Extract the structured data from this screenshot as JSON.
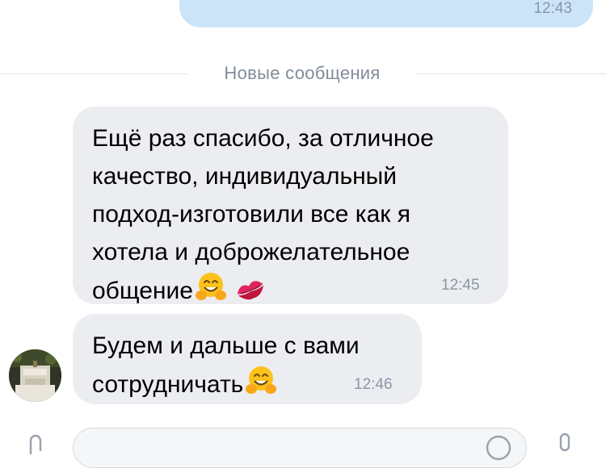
{
  "outgoing_message": {
    "time": "12:43"
  },
  "divider": {
    "label": "Новые сообщения"
  },
  "messages": [
    {
      "text": "Ещё раз спасибо, за отличное\nкачество, индивидуальный\nподход-изготовили все как я\nхотела и доброжелательное\nобщение",
      "emojis": [
        "hugging-face",
        "kiss-mark"
      ],
      "time": "12:45"
    },
    {
      "text": "Будем и дальше с вами\nсотрудничать",
      "emojis": [
        "hugging-face"
      ],
      "time": "12:46"
    }
  ],
  "colors": {
    "outgoing_bubble": "#cce4f7",
    "incoming_bubble": "#ebedf0",
    "divider_text": "#818c99",
    "time_text": "#8a97a6"
  },
  "composer": {
    "attach_icon": "paperclip-icon",
    "emoji_icon": "smile-icon",
    "mic_icon": "microphone-icon"
  }
}
